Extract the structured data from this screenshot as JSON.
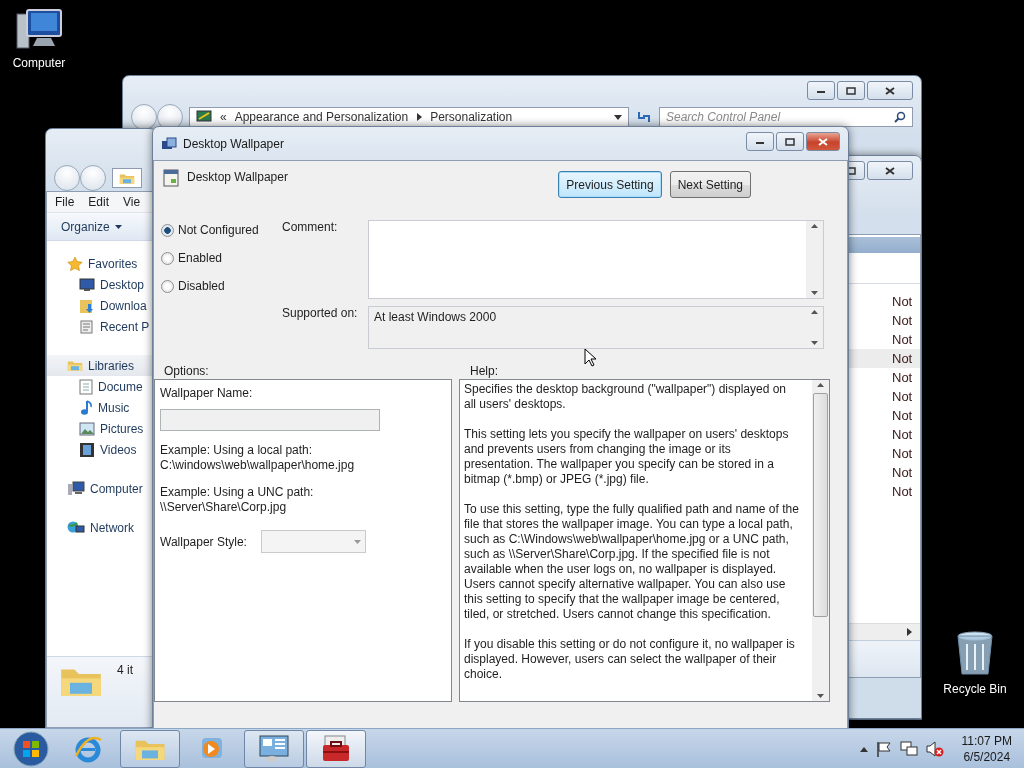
{
  "desktop_icons": [
    {
      "label": "Computer",
      "kind": "computer"
    },
    {
      "label": "Recycle Bin",
      "kind": "recycle"
    }
  ],
  "control_panel": {
    "breadcrumb_prefix": "«",
    "breadcrumb": [
      "Appearance and Personalization",
      "Personalization"
    ],
    "search": {
      "placeholder": "Search Control Panel"
    }
  },
  "policy_editor": {
    "rows": [
      {
        "state": "Not",
        "selected": false
      },
      {
        "state": "Not",
        "selected": false
      },
      {
        "state": "Not",
        "selected": false
      },
      {
        "state": "Not",
        "selected": true
      },
      {
        "state": "Not",
        "selected": false
      },
      {
        "state": "Not",
        "selected": false
      },
      {
        "state": "Not",
        "selected": false
      },
      {
        "state": "Not",
        "selected": false
      },
      {
        "state": "Not",
        "selected": false
      },
      {
        "state": "Not",
        "selected": false
      },
      {
        "state": "Not",
        "selected": false
      }
    ]
  },
  "explorer": {
    "menu": [
      "File",
      "Edit",
      "Vie"
    ],
    "organize": "Organize",
    "tree": [
      {
        "label": "Favorites",
        "kind": "star",
        "selected": false,
        "children": [
          {
            "label": "Desktop",
            "kind": "desktop",
            "selected": false
          },
          {
            "label": "Downloa",
            "kind": "downloads",
            "selected": false
          },
          {
            "label": "Recent P",
            "kind": "recent",
            "selected": false
          }
        ]
      },
      {
        "label": "Libraries",
        "kind": "library",
        "selected": true,
        "children": [
          {
            "label": "Docume",
            "kind": "document",
            "selected": false
          },
          {
            "label": "Music",
            "kind": "music",
            "selected": false
          },
          {
            "label": "Pictures",
            "kind": "pictures",
            "selected": false
          },
          {
            "label": "Videos",
            "kind": "videos",
            "selected": false
          }
        ]
      },
      {
        "label": "Computer",
        "kind": "computer",
        "selected": false
      },
      {
        "label": "Network",
        "kind": "network",
        "selected": false
      }
    ],
    "status": "4 it"
  },
  "dialog": {
    "title": "Desktop Wallpaper",
    "setting_name": "Desktop Wallpaper",
    "buttons": [
      {
        "label": "Previous Setting",
        "focused": true
      },
      {
        "label": "Next Setting",
        "focused": false
      }
    ],
    "radios": [
      {
        "label": "Not Configured",
        "selected": true
      },
      {
        "label": "Enabled",
        "selected": false
      },
      {
        "label": "Disabled",
        "selected": false
      }
    ],
    "comment_label": "Comment:",
    "supported_label": "Supported on:",
    "supported": "At least Windows 2000",
    "options_label": "Options:",
    "help_label": "Help:",
    "options": [
      {
        "kind": "label",
        "text": "Wallpaper Name:"
      },
      {
        "kind": "field",
        "disabled": true
      },
      {
        "kind": "text",
        "text": "Example: Using a local path:"
      },
      {
        "kind": "text",
        "text": "C:\\windows\\web\\wallpaper\\home.jpg"
      },
      {
        "kind": "text",
        "text": "Example: Using a UNC path:"
      },
      {
        "kind": "text",
        "text": "\\\\Server\\Share\\Corp.jpg"
      },
      {
        "kind": "select",
        "text": "Wallpaper Style:",
        "disabled": true
      }
    ],
    "help": [
      "Specifies the desktop background (\"wallpaper\") displayed on all users' desktops.",
      "This setting lets you specify the wallpaper on users' desktops and prevents users from changing the image or its presentation. The wallpaper you specify can be stored in a bitmap (*.bmp) or JPEG (*.jpg) file.",
      "To use this setting, type the fully qualified path and name of the file that stores the wallpaper image. You can type a local path, such as C:\\Windows\\web\\wallpaper\\home.jpg or a UNC path, such as \\\\Server\\Share\\Corp.jpg. If the specified file is not available when the user logs on, no wallpaper is displayed. Users cannot specify alternative wallpaper. You can also use this setting to specify that the wallpaper image be centered, tiled, or stretched. Users cannot change this specification.",
      "If you disable this setting or do not configure it, no wallpaper is displayed. However, users can select the wallpaper of their choice."
    ]
  },
  "taskbar": {
    "items": [
      {
        "kind": "ie",
        "running": false,
        "selected": false
      },
      {
        "kind": "explorer",
        "running": true,
        "selected": false
      },
      {
        "kind": "media",
        "running": false,
        "selected": false
      },
      {
        "kind": "control",
        "running": true,
        "selected": false
      },
      {
        "kind": "toolbox",
        "running": true,
        "selected": true
      }
    ],
    "tray": [
      {
        "kind": "arrow"
      },
      {
        "kind": "flag"
      },
      {
        "kind": "network"
      },
      {
        "kind": "volume-muted"
      }
    ],
    "time": "11:07 PM",
    "date": "6/5/2024"
  }
}
